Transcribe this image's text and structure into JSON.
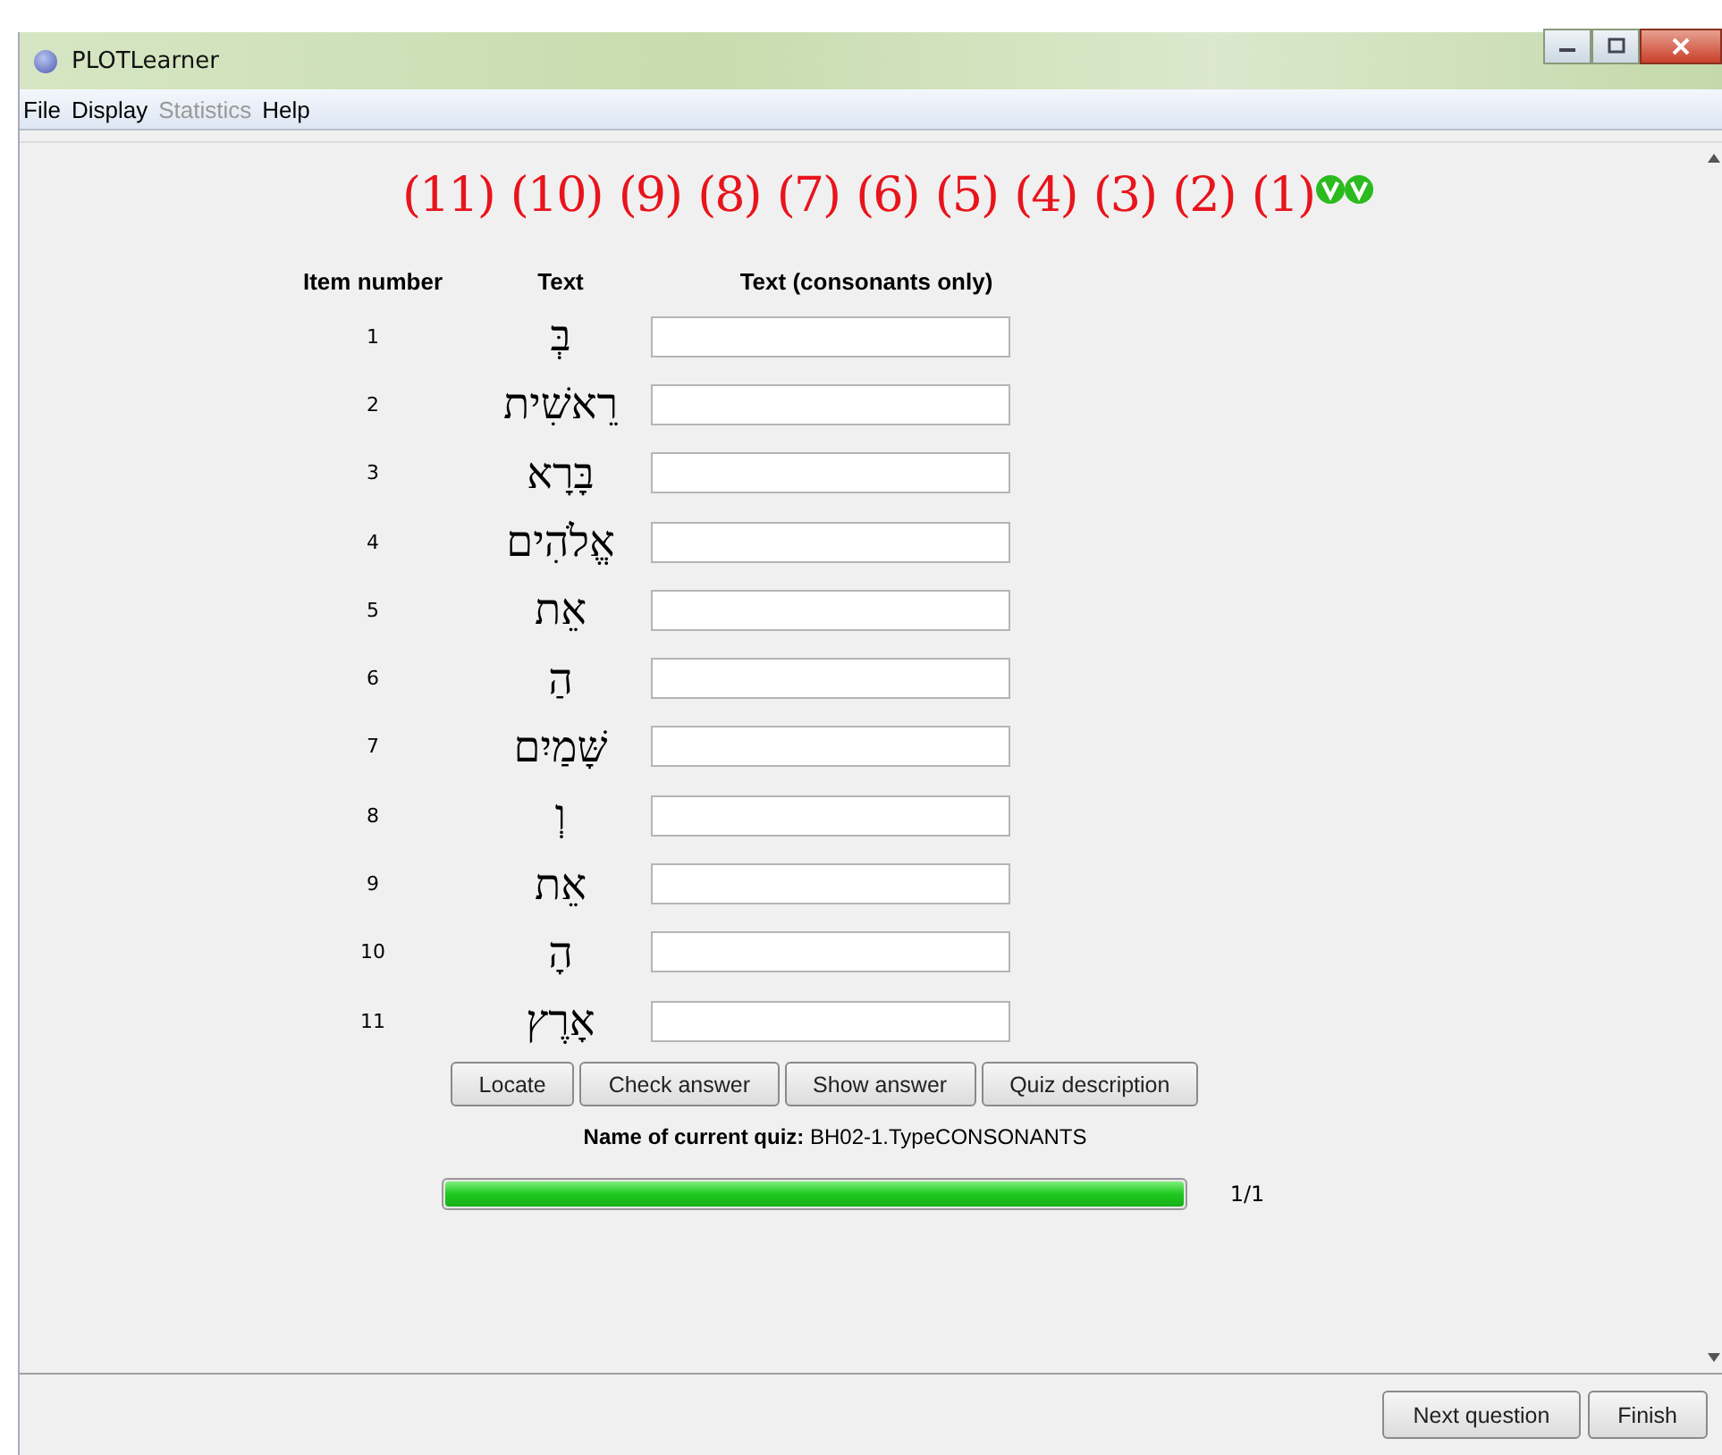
{
  "window": {
    "title": "PLOTLearner"
  },
  "menu": [
    {
      "label": "File",
      "disabled": false
    },
    {
      "label": "Display",
      "disabled": false
    },
    {
      "label": "Statistics",
      "disabled": true
    },
    {
      "label": "Help",
      "disabled": false
    }
  ],
  "question_markers": [
    "(11)",
    "(10)",
    "(9)",
    "(8)",
    "(7)",
    "(6)",
    "(5)",
    "(4)",
    "(3)",
    "(2)",
    "(1)"
  ],
  "table": {
    "columns": [
      "Item number",
      "Text",
      "Text (consonants only)"
    ],
    "rows": [
      {
        "number": "1",
        "text": "בְּ"
      },
      {
        "number": "2",
        "text": "רֵאשִׁית"
      },
      {
        "number": "3",
        "text": "בָּרָא"
      },
      {
        "number": "4",
        "text": "אֱלֹהִים"
      },
      {
        "number": "5",
        "text": "אֵת"
      },
      {
        "number": "6",
        "text": "הַ"
      },
      {
        "number": "7",
        "text": "שָּׁמַיִם"
      },
      {
        "number": "8",
        "text": "וְ"
      },
      {
        "number": "9",
        "text": "אֵת"
      },
      {
        "number": "10",
        "text": "הָ"
      },
      {
        "number": "11",
        "text": "אָרֶץ"
      }
    ]
  },
  "buttons": [
    "Locate",
    "Check answer",
    "Show answer",
    "Quiz description"
  ],
  "quiz_name": {
    "label": "Name of current quiz:",
    "value": "BH02-1.TypeCONSONANTS"
  },
  "progress": {
    "level": 1,
    "reading": "1/1"
  },
  "footer_buttons": [
    "Next question",
    "Finish"
  ]
}
